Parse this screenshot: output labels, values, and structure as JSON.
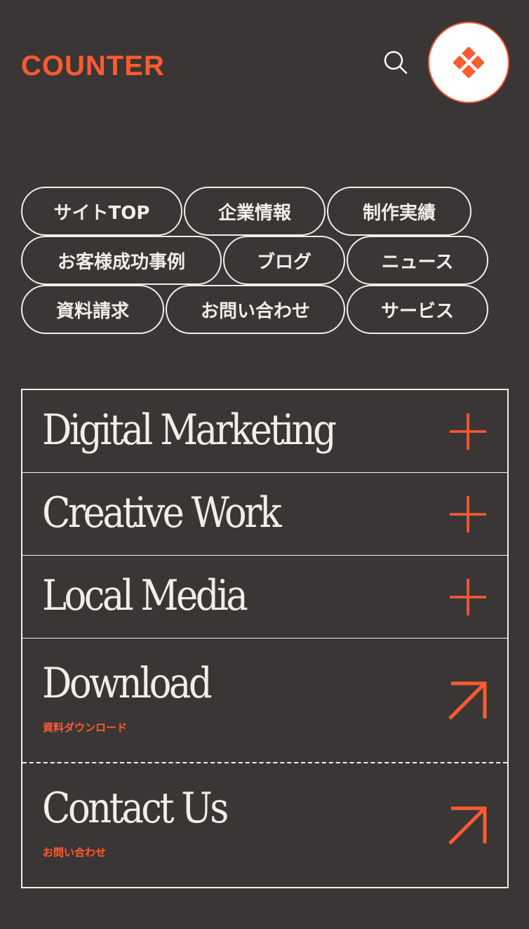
{
  "header": {
    "logo": "COUNTER",
    "search_icon": "search-icon",
    "menu_icon": "diamond-grid-icon",
    "accent_color": "#ff5a30"
  },
  "nav_chips": [
    [
      "サイトTOP",
      "企業情報",
      "制作実績"
    ],
    [
      "お客様成功事例",
      "ブログ",
      "ニュース"
    ],
    [
      "資料請求",
      "お問い合わせ",
      "サービス"
    ]
  ],
  "menu": [
    {
      "title": "Digital Marketing",
      "icon": "plus-icon"
    },
    {
      "title": "Creative Work",
      "icon": "plus-icon"
    },
    {
      "title": "Local Media",
      "icon": "plus-icon"
    },
    {
      "title": "Download",
      "subtitle": "資料ダウンロード",
      "icon": "arrow-up-right-icon"
    },
    {
      "title": "Contact Us",
      "subtitle": "お問い合わせ",
      "icon": "arrow-up-right-icon"
    }
  ]
}
